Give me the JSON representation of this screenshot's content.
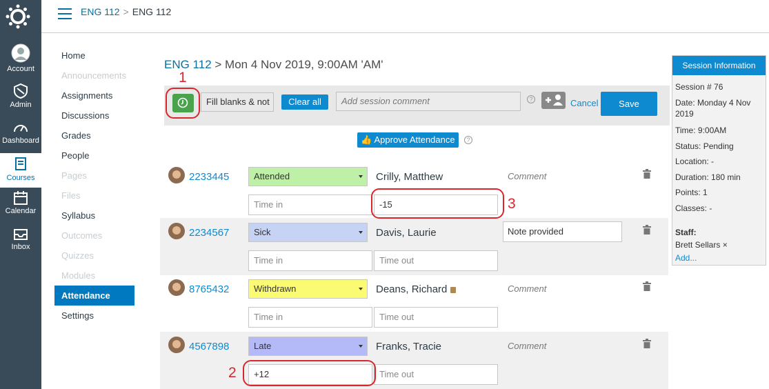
{
  "global_nav": {
    "items": [
      {
        "label": "Account"
      },
      {
        "label": "Admin"
      },
      {
        "label": "Dashboard"
      },
      {
        "label": "Courses"
      },
      {
        "label": "Calendar"
      },
      {
        "label": "Inbox"
      }
    ]
  },
  "header": {
    "breadcrumb": [
      "ENG 112",
      "ENG 112"
    ],
    "separator": ">"
  },
  "course_nav": {
    "items": [
      {
        "label": "Home",
        "state": "enabled"
      },
      {
        "label": "Announcements",
        "state": "disabled"
      },
      {
        "label": "Assignments",
        "state": "enabled"
      },
      {
        "label": "Discussions",
        "state": "enabled"
      },
      {
        "label": "Grades",
        "state": "enabled"
      },
      {
        "label": "People",
        "state": "enabled"
      },
      {
        "label": "Pages",
        "state": "disabled"
      },
      {
        "label": "Files",
        "state": "disabled"
      },
      {
        "label": "Syllabus",
        "state": "enabled"
      },
      {
        "label": "Outcomes",
        "state": "disabled"
      },
      {
        "label": "Quizzes",
        "state": "disabled"
      },
      {
        "label": "Modules",
        "state": "disabled"
      },
      {
        "label": "Attendance",
        "state": "active"
      },
      {
        "label": "Settings",
        "state": "enabled"
      }
    ]
  },
  "main": {
    "title_link": "ENG 112",
    "title_rest": "> Mon 4 Nov 2019, 9:00AM 'AM'",
    "toolbar": {
      "fill_select": "Fill blanks & not",
      "clear_all": "Clear all",
      "comment_placeholder": "Add session comment",
      "help": "?",
      "cancel": "Cancel",
      "save": "Save"
    },
    "approve_button": "Approve Attendance",
    "students": [
      {
        "id": "2233445",
        "status": "Attended",
        "status_color": "#bff0a8",
        "name": "Crilly, Matthew",
        "comment": "Comment",
        "note": "",
        "time_in": "",
        "time_out": "-15"
      },
      {
        "id": "2234567",
        "status": "Sick",
        "status_color": "#c7d3f5",
        "name": "Davis, Laurie",
        "comment": "",
        "note": "Note provided",
        "time_in": "",
        "time_out": ""
      },
      {
        "id": "8765432",
        "status": "Withdrawn",
        "status_color": "#fbfb73",
        "name": "Deans, Richard",
        "comment": "Comment",
        "note": "",
        "time_in": "",
        "time_out": ""
      },
      {
        "id": "4567898",
        "status": "Late",
        "status_color": "#b3baf7",
        "name": "Franks, Tracie",
        "comment": "Comment",
        "note": "",
        "time_in": "+12",
        "time_out": ""
      }
    ],
    "placeholders": {
      "time_in": "Time in",
      "time_out": "Time out"
    },
    "annotations": [
      "1",
      "2",
      "3"
    ]
  },
  "session_info": {
    "title": "Session Information",
    "session_no": "Session # 76",
    "date_line1": "Date: Monday 4 Nov",
    "date_line2": "2019",
    "time": "Time: 9:00AM",
    "status": "Status: Pending",
    "location": "Location: -",
    "duration": "Duration: 180 min",
    "points": "Points: 1",
    "classes": "Classes: -",
    "staff_label": "Staff:",
    "staff_name": "Brett Sellars",
    "remove": "×",
    "add": "Add..."
  },
  "colors": {
    "accent": "#0e8ad1",
    "nav_bg": "#394b58",
    "annotation_red": "#d9262c",
    "clock_green": "#4aa34c"
  }
}
